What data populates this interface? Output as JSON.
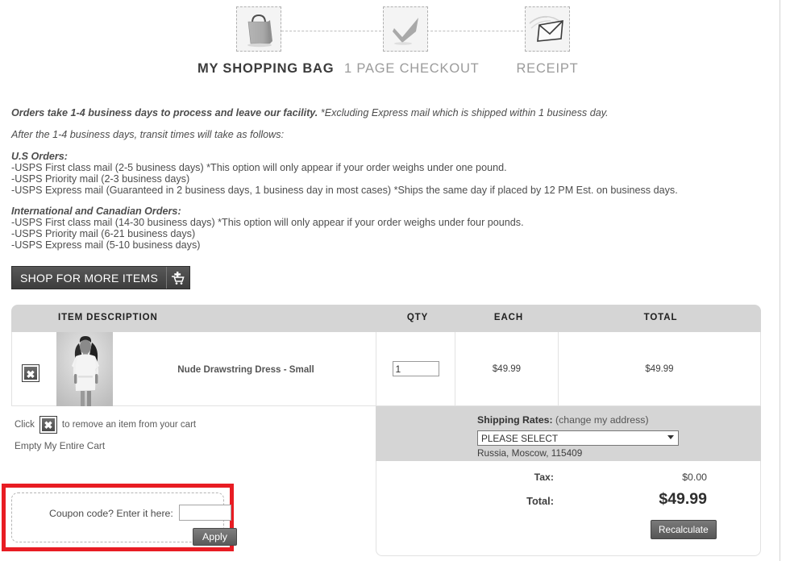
{
  "steps": [
    {
      "label": "MY SHOPPING BAG",
      "icon": "shopping-bag-icon",
      "state": "active"
    },
    {
      "label": "1 PAGE CHECKOUT",
      "icon": "checkmark-icon",
      "state": "inactive"
    },
    {
      "label": "RECEIPT",
      "icon": "envelope-icon",
      "state": "inactive"
    }
  ],
  "policy": {
    "line1_bold": "Orders take 1-4 business days to process and leave our facility.",
    "line1_rest": " *Excluding Express mail which is shipped within 1 business day.",
    "line2": "After the 1-4 business days, transit times will take as follows:",
    "us_heading": "U.S Orders:",
    "us_lines": [
      "-USPS First class mail (2-5 business days) *This option will only appear if your order weighs under one pound.",
      "-USPS Priority mail (2-3 business days)",
      "-USPS Express mail (Guaranteed in 2 business days, 1 business day in most cases) *Ships the same day if placed by 12 PM Est. on business days."
    ],
    "intl_heading": "International and Canadian Orders:",
    "intl_lines": [
      "-USPS First class mail (14-30 business days) *This option will only appear if your order weighs under four pounds.",
      "-USPS Priority mail (6-21 business days)",
      "-USPS Express mail (5-10 business days)"
    ]
  },
  "shop_button": {
    "label": "SHOP FOR MORE ITEMS",
    "icon": "add-to-cart-icon"
  },
  "cart": {
    "headers": {
      "item": "ITEM DESCRIPTION",
      "qty": "QTY",
      "each": "EACH",
      "total": "TOTAL"
    },
    "items": [
      {
        "remove_label": "✖",
        "name": "Nude Drawstring Dress - Small",
        "qty": "1",
        "each": "$49.99",
        "total": "$49.99"
      }
    ],
    "note_prefix": "Click",
    "note_suffix": "to remove an item from your cart",
    "empty_cart_link": "Empty My Entire Cart"
  },
  "shipping": {
    "title": "Shipping Rates:",
    "change_address_link": "(change my address)",
    "selected_rate": "PLEASE SELECT",
    "address": "Russia, Moscow, 115409"
  },
  "totals": {
    "tax_label": "Tax:",
    "tax_value": "$0.00",
    "total_label": "Total:",
    "total_value": "$49.99",
    "recalculate_label": "Recalculate"
  },
  "coupon": {
    "label": "Coupon code? Enter it here:",
    "value": "",
    "placeholder": "",
    "apply_label": "Apply",
    "highlight_color": "#e81c23"
  }
}
